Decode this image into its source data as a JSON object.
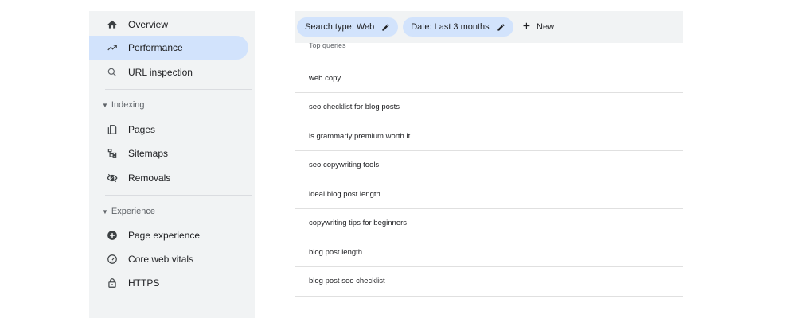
{
  "sidebar": {
    "items": [
      {
        "label": "Overview",
        "icon": "home-icon"
      },
      {
        "label": "Performance",
        "icon": "trending-up-icon",
        "active": true
      },
      {
        "label": "URL inspection",
        "icon": "search-icon"
      }
    ],
    "indexing": {
      "header": "Indexing",
      "items": [
        {
          "label": "Pages",
          "icon": "pages-icon"
        },
        {
          "label": "Sitemaps",
          "icon": "sitemap-icon"
        },
        {
          "label": "Removals",
          "icon": "removals-icon"
        }
      ]
    },
    "experience": {
      "header": "Experience",
      "items": [
        {
          "label": "Page experience",
          "icon": "page-experience-icon"
        },
        {
          "label": "Core web vitals",
          "icon": "gauge-icon"
        },
        {
          "label": "HTTPS",
          "icon": "lock-icon"
        }
      ]
    }
  },
  "filters": {
    "search_type": "Search type: Web",
    "date": "Date: Last 3 months",
    "new_label": "New"
  },
  "table": {
    "header": "Top queries",
    "rows": [
      "web copy",
      "seo checklist for blog posts",
      "is grammarly premium worth it",
      "seo copywriting tools",
      "ideal blog post length",
      "copywriting tips for beginners",
      "blog post length",
      "blog post seo checklist"
    ]
  },
  "colors": {
    "active_bg": "#d2e3fc",
    "sidebar_bg": "#f1f3f4",
    "chip_bg": "#d2e3fc"
  }
}
